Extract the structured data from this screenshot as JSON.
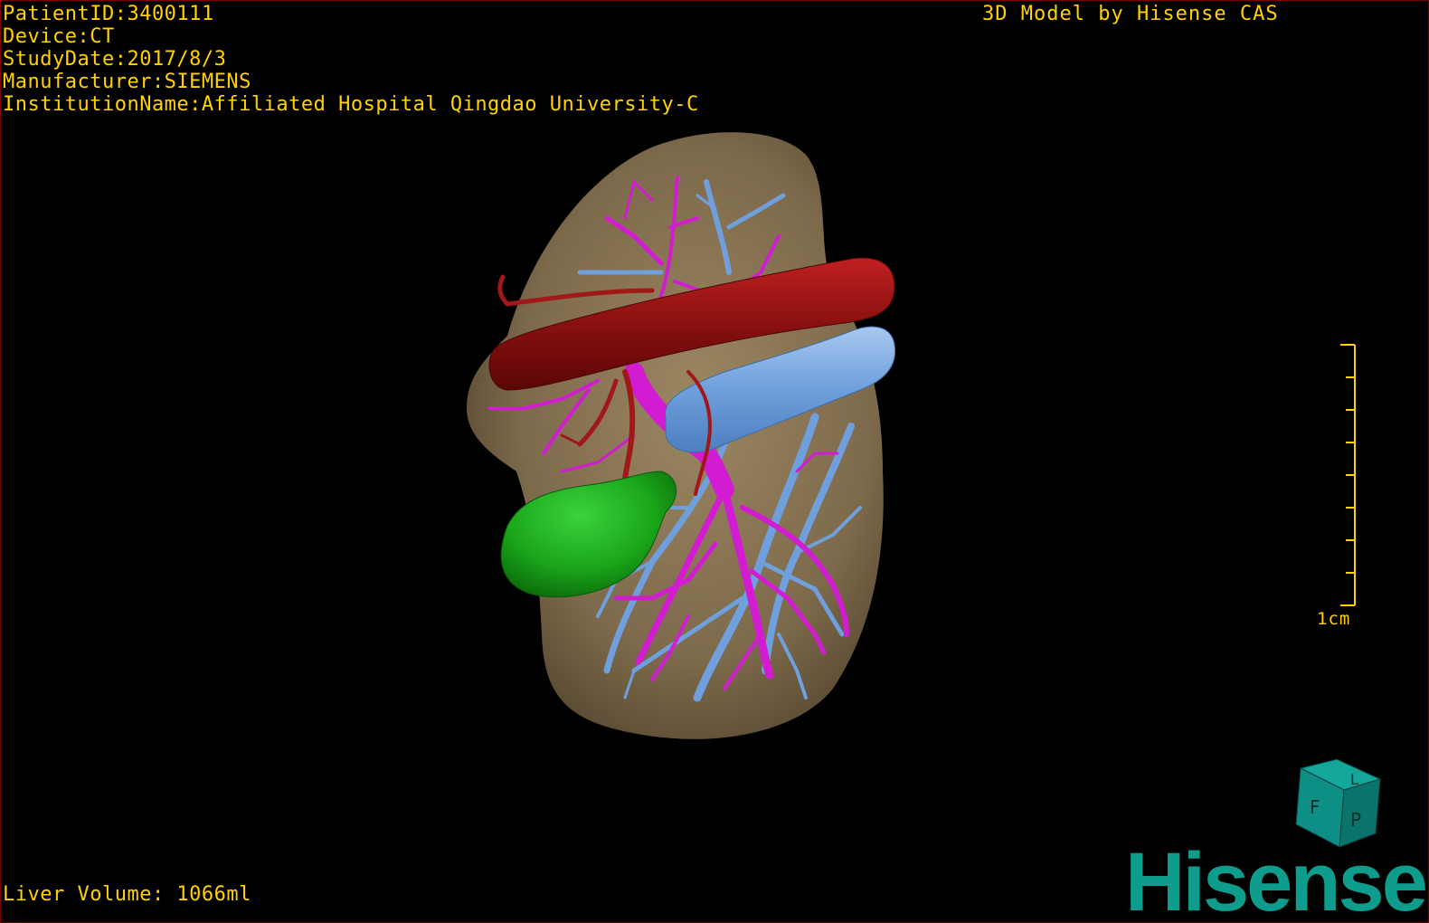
{
  "patient_info": {
    "patient_id": "PatientID:3400111",
    "device": "Device:CT",
    "study_date": "StudyDate:2017/8/3",
    "manufacturer": "Manufacturer:SIEMENS",
    "institution": "InstitutionName:Affiliated Hospital Qingdao University-C"
  },
  "model_credit": "3D Model by Hisense CAS",
  "liver_volume": "Liver Volume: 1066ml",
  "scale_bar": {
    "label": "1cm",
    "tick_count": 9
  },
  "orientation_cube": {
    "faces": [
      "F",
      "L",
      "P"
    ],
    "color": "#0e8f86"
  },
  "brand_logo": {
    "text": "Hisense",
    "color": "#0e9c8c"
  },
  "structure_colors": {
    "liver": "#8a7654",
    "artery_aorta": "#9a1414",
    "portal_vein": "#d21cd2",
    "hepatic_vein": "#6f9fdc",
    "gallbladder": "#1aa61a"
  }
}
